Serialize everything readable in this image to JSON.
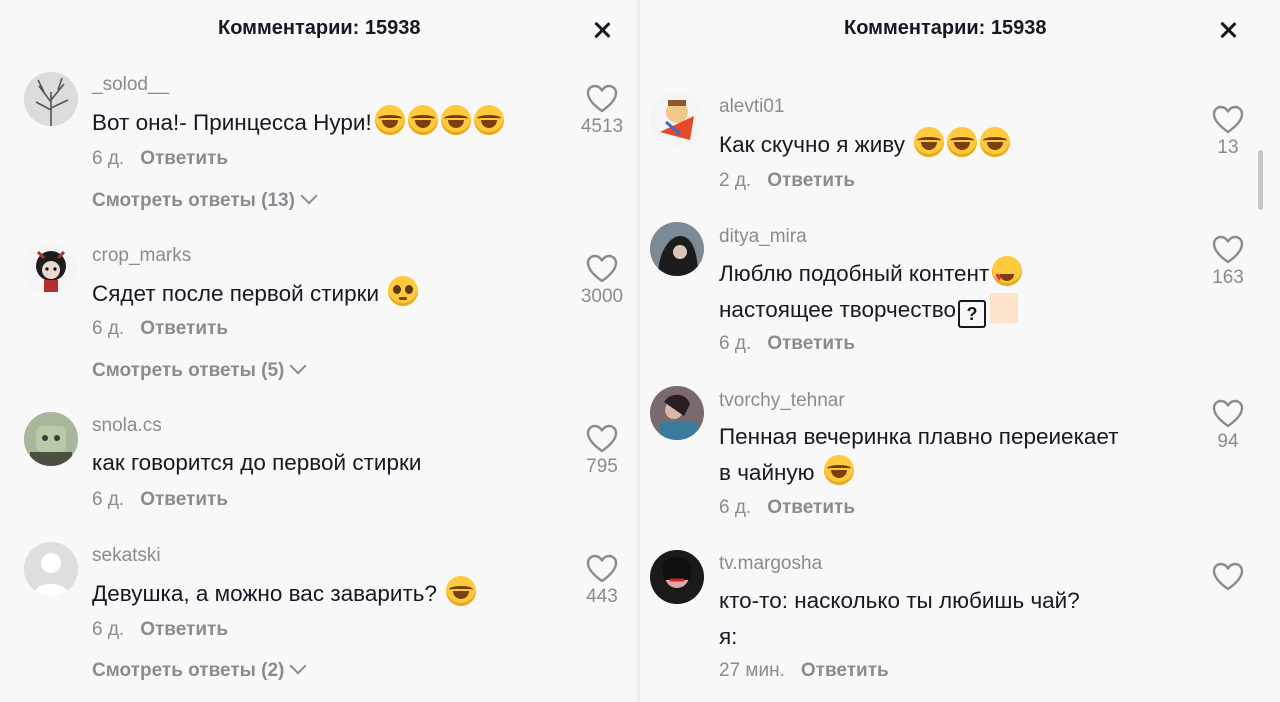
{
  "left_panel": {
    "title": "Комментарии: 15938",
    "comments": [
      {
        "username": "_solod__",
        "text": "Вот она!- Принцесса Нури!",
        "time": "6 д.",
        "reply": "Ответить",
        "likes": "4513",
        "view_replies": "Смотреть ответы (13)"
      },
      {
        "username": "crop_marks",
        "text": "Сядет после первой стирки",
        "time": "6 д.",
        "reply": "Ответить",
        "likes": "3000",
        "view_replies": "Смотреть ответы (5)"
      },
      {
        "username": "snola.cs",
        "text": "как говорится до первой стирки",
        "time": "6 д.",
        "reply": "Ответить",
        "likes": "795"
      },
      {
        "username": "sekatski",
        "text": "Девушка, а можно вас заварить?",
        "time": "6 д.",
        "reply": "Ответить",
        "likes": "443",
        "view_replies": "Смотреть ответы (2)"
      }
    ]
  },
  "right_panel": {
    "title": "Комментарии: 15938",
    "comments": [
      {
        "username": "alevti01",
        "text": "Как скучно я живу",
        "time": "2 д.",
        "reply": "Ответить",
        "likes": "13"
      },
      {
        "username": "ditya_mira",
        "text_line1": "Люблю подобный контент",
        "text_line2": "настоящее творчество",
        "time": "6 д.",
        "reply": "Ответить",
        "likes": "163"
      },
      {
        "username": "tvorchy_tehnar",
        "text_line1": "Пенная вечеринка плавно переиекает",
        "text_line2": "в чайную",
        "time": "6 д.",
        "reply": "Ответить",
        "likes": "94"
      },
      {
        "username": "tv.margosha",
        "text_line1": "кто-то: насколько ты любишь чай?",
        "text_line2": "я:",
        "time": "27 мин.",
        "reply": "Ответить"
      }
    ]
  },
  "icons": {
    "close": "close-icon",
    "like": "heart-outline-icon",
    "expand": "chevron-down-icon"
  }
}
